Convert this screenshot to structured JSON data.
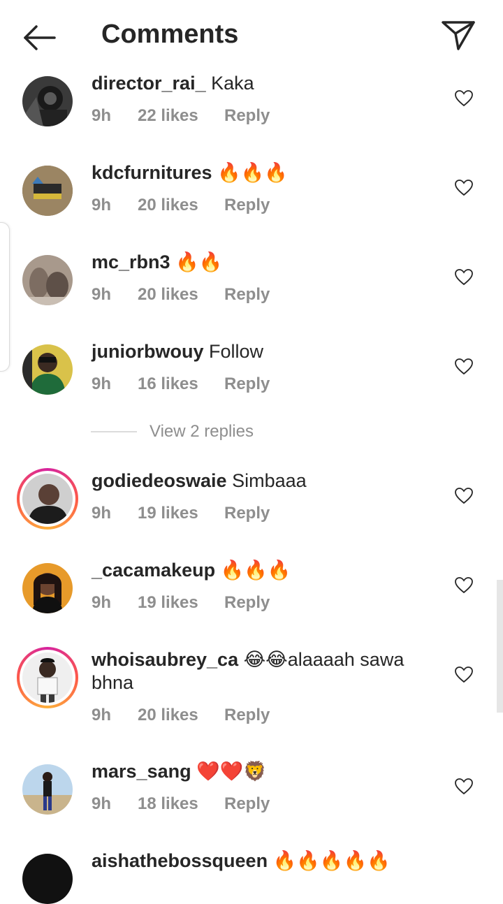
{
  "header": {
    "title": "Comments",
    "back_icon": "arrow-left-icon",
    "share_icon": "paper-plane-icon"
  },
  "comments": [
    {
      "username": "director_rai_",
      "text": "Kaka",
      "time": "9h",
      "likes": "22 likes",
      "reply": "Reply"
    },
    {
      "username": "kdcfurnitures",
      "text": "🔥🔥🔥",
      "time": "9h",
      "likes": "20 likes",
      "reply": "Reply"
    },
    {
      "username": "mc_rbn3",
      "text": "🔥🔥",
      "time": "9h",
      "likes": "20 likes",
      "reply": "Reply"
    },
    {
      "username": "juniorbwouy",
      "text": "Follow",
      "time": "9h",
      "likes": "16 likes",
      "reply": "Reply"
    },
    {
      "username": "godiedeoswaie",
      "text": "Simbaaa",
      "time": "9h",
      "likes": "19 likes",
      "reply": "Reply"
    },
    {
      "username": "_cacamakeup",
      "text": "🔥🔥🔥",
      "time": "9h",
      "likes": "19 likes",
      "reply": "Reply"
    },
    {
      "username": "whoisaubrey_ca",
      "text": "😂😂alaaaah sawa bhna",
      "time": "9h",
      "likes": "20 likes",
      "reply": "Reply"
    },
    {
      "username": "mars_sang",
      "text": "❤️❤️🦁",
      "time": "9h",
      "likes": "18 likes",
      "reply": "Reply"
    },
    {
      "username": "aishathebossqueen",
      "text": "🔥🔥🔥🔥🔥",
      "time": "",
      "likes": "",
      "reply": ""
    }
  ],
  "view_replies": "View 2 replies",
  "colors": {
    "text": "#262626",
    "muted": "#8e8e8e",
    "story_ring_start": "#d6249f",
    "story_ring_end": "#fdb03b"
  }
}
